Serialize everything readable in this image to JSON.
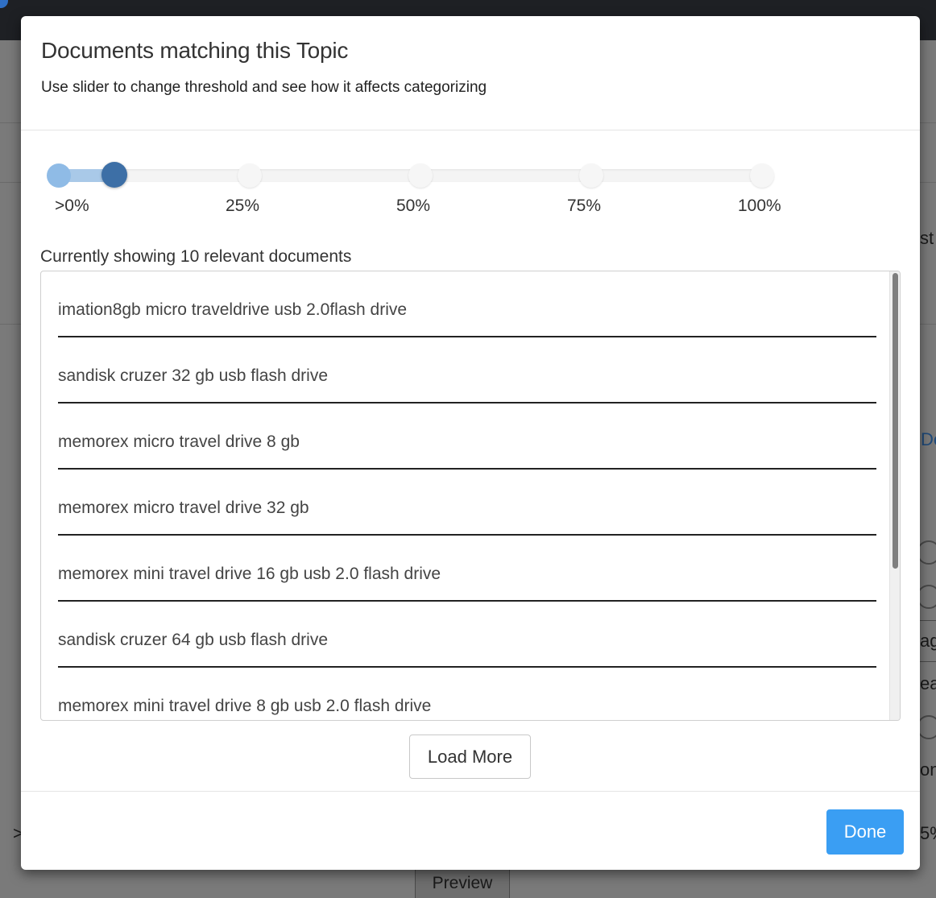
{
  "modal": {
    "title": "Documents matching this Topic",
    "subtitle": "Use slider to change threshold and see how it affects categorizing"
  },
  "slider": {
    "ticks": [
      ">0%",
      "25%",
      "50%",
      "75%",
      "100%"
    ],
    "selected": ">0%",
    "selected_fraction": 0.0
  },
  "status": {
    "showing_text": "Currently showing 10 relevant documents"
  },
  "documents": [
    "imation8gb micro traveldrive usb 2.0flash drive",
    "sandisk cruzer 32 gb usb flash drive",
    "memorex micro travel drive 8 gb",
    "memorex micro travel drive 32 gb",
    "memorex mini travel drive 16 gb usb 2.0 flash drive",
    "sandisk cruzer 64 gb usb flash drive",
    "memorex mini travel drive 8 gb usb 2.0 flash drive"
  ],
  "buttons": {
    "load_more": "Load More",
    "done": "Done"
  },
  "background": {
    "fragment_st": "st",
    "fragment_de": "De",
    "fragment_ag": "ag",
    "fragment_ea": "ea",
    "fragment_on": "on",
    "fragment_gt": ">",
    "fragment_pct": "5%",
    "preview_tab": "Preview"
  },
  "colors": {
    "primary": "#3a9ef3",
    "slider_handle": "#3d6fa6",
    "slider_fill": "#a9c9e8"
  }
}
